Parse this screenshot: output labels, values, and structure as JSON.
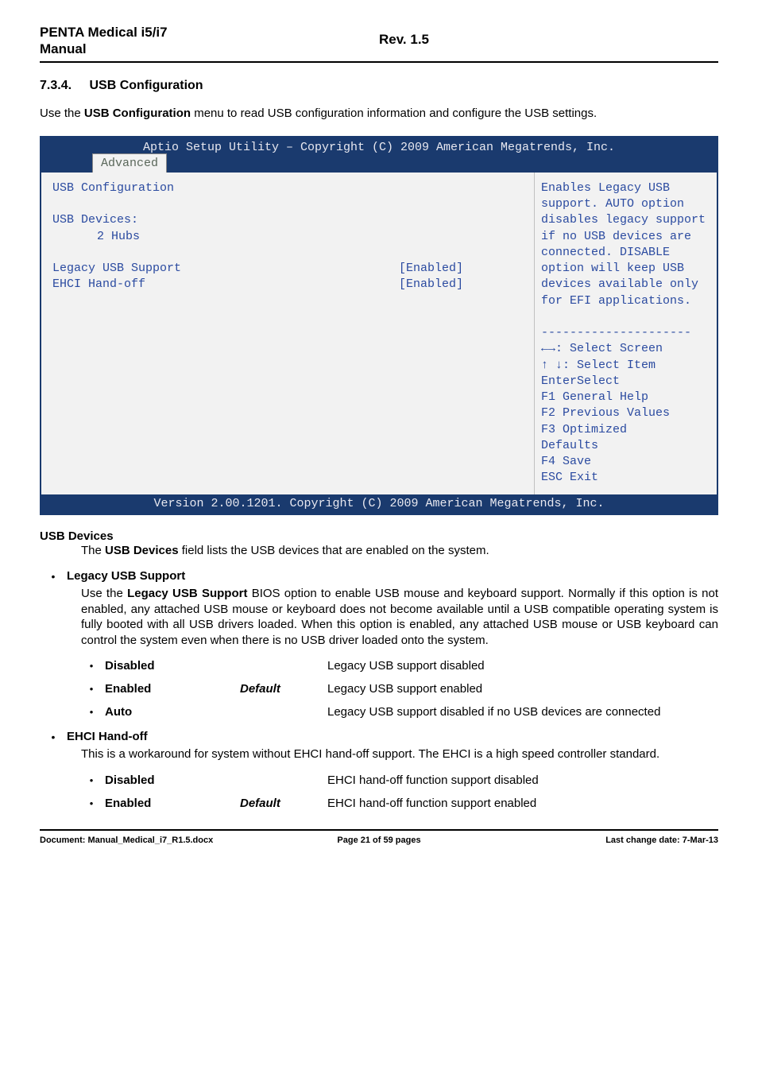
{
  "header": {
    "product_line1": "PENTA Medical i5/i7",
    "product_line2": "Manual",
    "rev": "Rev. 1.5"
  },
  "section": {
    "number": "7.3.4.",
    "title": "USB Configuration"
  },
  "intro": {
    "pre": "Use the ",
    "bold": "USB Configuration",
    "post": " menu to read USB configuration information and configure the USB settings."
  },
  "bios": {
    "titlebar": "Aptio Setup Utility – Copyright (C) 2009 American Megatrends, Inc.",
    "tab": "Advanced",
    "left": {
      "heading": "USB Configuration",
      "devices_label": "USB Devices:",
      "devices_value": "2 Hubs",
      "rows": [
        {
          "label": "Legacy USB Support",
          "value": "[Enabled]"
        },
        {
          "label": "EHCI Hand-off",
          "value": "[Enabled]"
        }
      ]
    },
    "right": {
      "help": "Enables Legacy USB support. AUTO option disables legacy support if no USB devices are connected. DISABLE option will keep USB devices available only for EFI applications.",
      "hints": [
        {
          "key": "←→:",
          "text": " Select Screen"
        },
        {
          "key": "↑ ↓:",
          "text": " Select Item"
        },
        {
          "key": "Enter",
          "text": "Select"
        },
        {
          "key": "F1",
          "text": "   General Help"
        },
        {
          "key": "F2",
          "text": "   Previous Values"
        },
        {
          "key": "F3",
          "text": "   Optimized"
        },
        {
          "key": "Defaults",
          "text": ""
        },
        {
          "key": "F4",
          "text": "   Save"
        },
        {
          "key": "ESC",
          "text": "  Exit"
        }
      ]
    },
    "footer": "Version 2.00.1201. Copyright (C) 2009 American Megatrends, Inc."
  },
  "usbdev": {
    "head": "USB Devices",
    "pre": "The ",
    "bold": "USB Devices",
    "post": " field lists the USB devices that are enabled on the system."
  },
  "legacy": {
    "bullet_title": "Legacy USB Support",
    "pre": "Use the ",
    "bold": "Legacy USB Support",
    "post": " BIOS option to enable USB mouse and keyboard support. Normally if this option is not enabled, any attached USB mouse or keyboard does not become available until a USB compatible operating system is fully booted with all USB drivers loaded. When this option is enabled, any attached USB mouse or USB keyboard can control the system even when there is no USB driver loaded onto the system.",
    "options": [
      {
        "name": "Disabled",
        "def": "",
        "desc": "Legacy USB support disabled"
      },
      {
        "name": "Enabled",
        "def": "Default",
        "desc": "Legacy USB support enabled"
      },
      {
        "name": "Auto",
        "def": "",
        "desc": "Legacy USB support disabled if no USB devices are connected"
      }
    ]
  },
  "ehci": {
    "bullet_title": "EHCI Hand-off",
    "para": "This is a workaround for system without EHCI hand-off support. The EHCI is a high speed controller standard.",
    "options": [
      {
        "name": "Disabled",
        "def": "",
        "desc": "EHCI hand-off function support disabled"
      },
      {
        "name": "Enabled",
        "def": "Default",
        "desc": "EHCI hand-off function support enabled"
      }
    ]
  },
  "footer": {
    "doc": "Document: Manual_Medical_i7_R1.5.docx",
    "page": "Page 21 of 59 pages",
    "date": "Last change date: 7-Mar-13"
  }
}
